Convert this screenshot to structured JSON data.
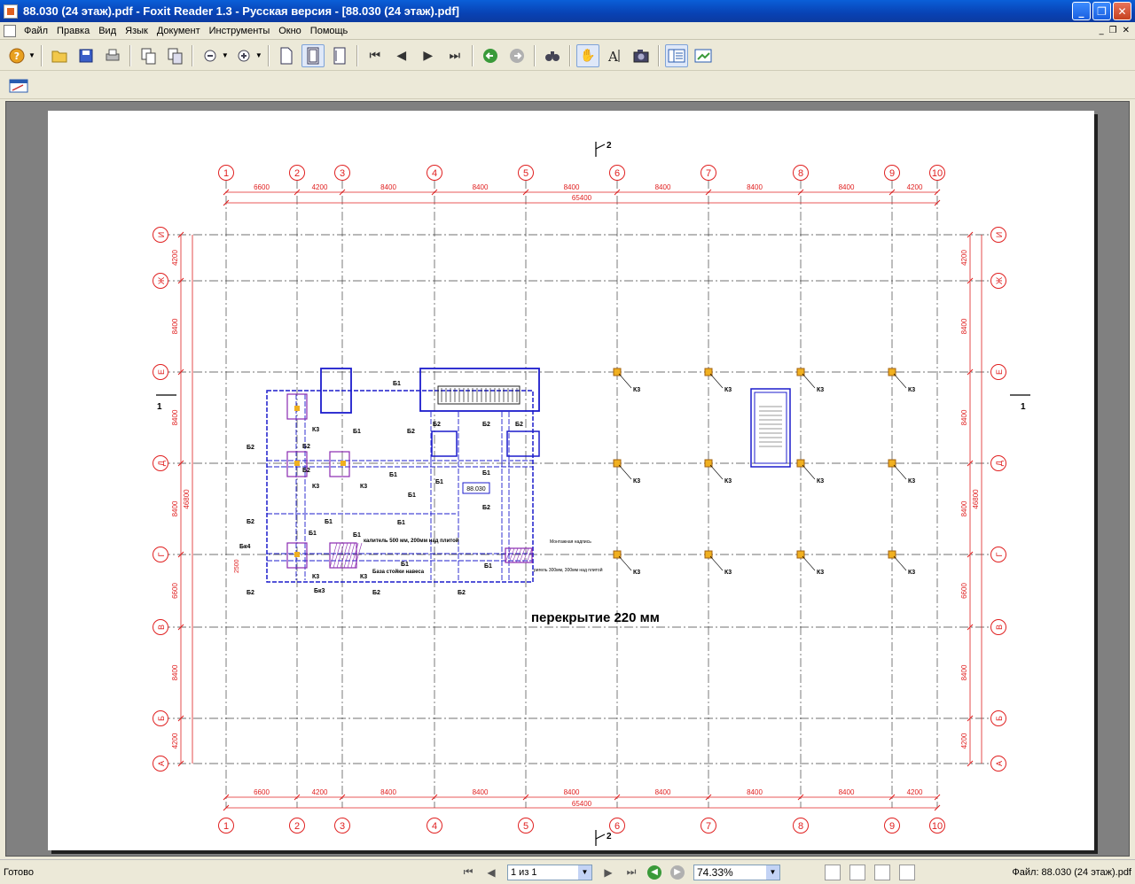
{
  "window": {
    "title": "88.030 (24 этаж).pdf - Foxit Reader 1.3 - Русская версия  - [88.030 (24 этаж).pdf]",
    "minimize": "_",
    "maximize": "❐",
    "close": "✕"
  },
  "menu": {
    "items": [
      "Файл",
      "Правка",
      "Вид",
      "Язык",
      "Документ",
      "Инструменты",
      "Окно",
      "Помощь"
    ],
    "mdi_min": "_",
    "mdi_restore": "❐",
    "mdi_close": "✕"
  },
  "toolbar": {
    "icons": [
      "help-icon",
      "open-icon",
      "save-icon",
      "print-icon",
      "copy-page-icon",
      "paste-page-icon",
      "zoom-out-icon",
      "zoom-in-icon",
      "actual-size-icon",
      "fit-page-icon",
      "fit-width-icon",
      "first-page-icon",
      "prev-page-icon",
      "next-page-icon",
      "last-page-icon",
      "back-icon",
      "forward-icon",
      "find-icon",
      "hand-tool-icon",
      "text-select-icon",
      "snapshot-icon",
      "bookmarks-icon",
      "thumbnails-icon"
    ]
  },
  "drawing": {
    "col_labels": [
      "1",
      "2",
      "3",
      "4",
      "5",
      "6",
      "7",
      "8",
      "9",
      "10"
    ],
    "col_spans": [
      "6600",
      "4200",
      "8400",
      "8400",
      "8400",
      "8400",
      "8400",
      "8400",
      "4200"
    ],
    "col_total": "65400",
    "row_labels": [
      "И",
      "Ж",
      "Е",
      "Д",
      "Г",
      "В",
      "Б",
      "А"
    ],
    "row_spans": [
      "4200",
      "8400",
      "8400",
      "8400",
      "6600",
      "8400",
      "4200"
    ],
    "row_total": "46800",
    "section_mark_2": "2",
    "section_mark_1": "1",
    "floor_note": "перекрытие 220 мм",
    "sheet_label": "88.030",
    "beam_b1": "Б1",
    "beam_b2": "Б2",
    "column_k3": "К3",
    "beam_bk3": "Бк3",
    "beam_bk4": "Бк4",
    "dim_2500": "2500",
    "note_heater": "калитель 500 мм, 200мм над плитой",
    "note_base": "База стойки навеса",
    "note_right1": "Монтажная надпись",
    "note_right2": "ригель 300мм, 300мм над плитой"
  },
  "status": {
    "ready": "Готово",
    "page": "1 из 1",
    "zoom": "74.33%",
    "file": "Файл: 88.030 (24 этаж).pdf"
  }
}
